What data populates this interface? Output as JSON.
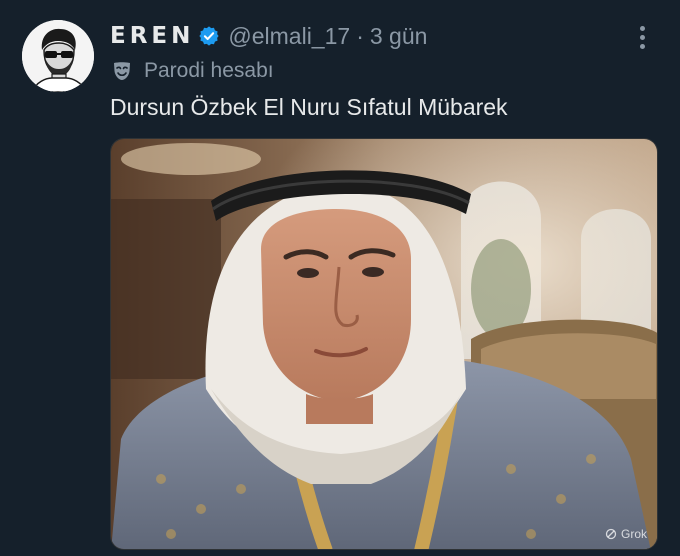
{
  "author": {
    "display_name": "EREN",
    "handle": "@elmali_17",
    "separator": "·",
    "timestamp": "3 gün",
    "verified_icon": "verified-badge-icon",
    "parody_label": "Parodi hesabı",
    "parody_icon": "theater-mask-icon"
  },
  "tweet": {
    "text": "Dursun Özbek El Nuru Sıfatul Mübarek"
  },
  "media": {
    "watermark": "Grok",
    "watermark_icon": "grok-icon"
  },
  "colors": {
    "background": "#15202b",
    "text_primary": "#e7e9ea",
    "text_secondary": "#8b98a5",
    "verified_blue": "#1d9bf0"
  }
}
